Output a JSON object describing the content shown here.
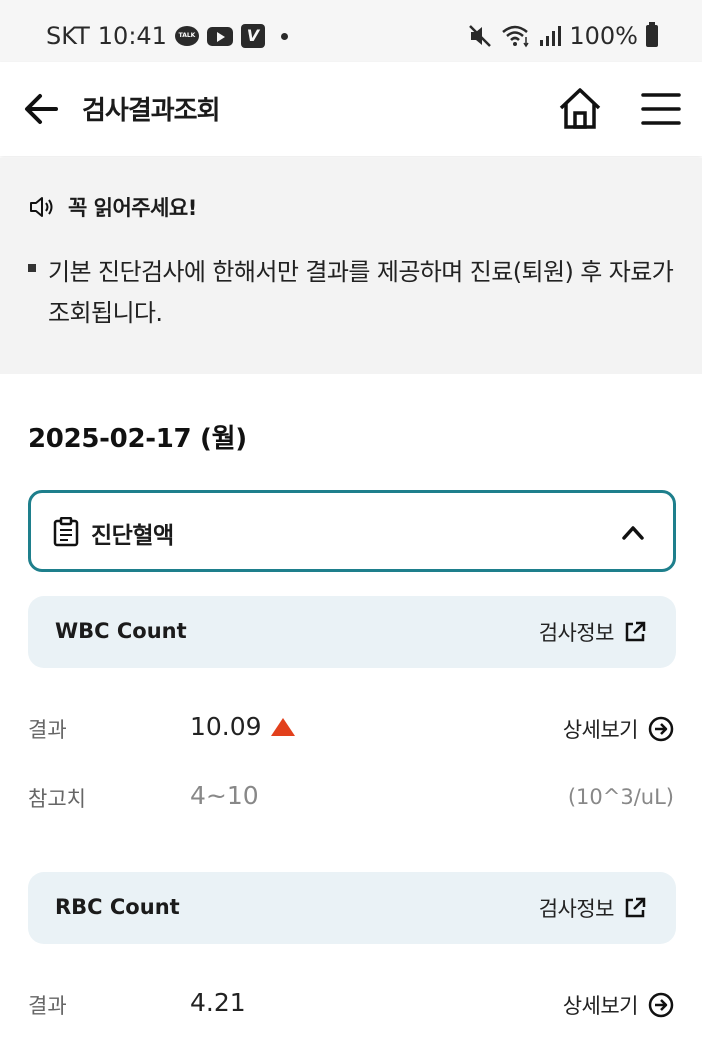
{
  "status_bar": {
    "carrier": "SKT",
    "time": "10:41",
    "talk_badge": "TALK",
    "app_badge": "V",
    "battery": "100%"
  },
  "header": {
    "title": "검사결과조회"
  },
  "notice": {
    "title": "꼭 읽어주세요!",
    "text": "기본 진단검사에 한해서만 결과를 제공하며 진료(퇴원) 후 자료가 조회됩니다."
  },
  "date_label": "2025-02-17 (월)",
  "category": {
    "title": "진단혈액",
    "expanded": true
  },
  "labels": {
    "result": "결과",
    "reference": "참고치",
    "test_info": "검사정보",
    "detail": "상세보기"
  },
  "tests": [
    {
      "name": "WBC Count",
      "result": "10.09",
      "flag": "high",
      "reference": "4~10",
      "unit": "(10^3/uL)"
    },
    {
      "name": "RBC Count",
      "result": "4.21"
    }
  ],
  "colors": {
    "accent_border": "#1e7f8c",
    "item_header_bg": "#eaf2f6",
    "notice_bg": "#f3f3f3",
    "high_flag": "#e2401c"
  }
}
